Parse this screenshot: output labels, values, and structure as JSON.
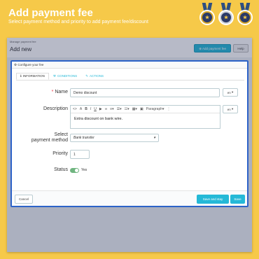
{
  "hero": {
    "title": "Add payment fee",
    "subtitle": "Select payment method and priority to add payment fee/discount"
  },
  "admin": {
    "breadcrumb": "Manage payment fee",
    "page_title": "Add new",
    "add_button": "Add payment fee",
    "help_button": "Help"
  },
  "modal": {
    "title": "Configure your fee",
    "tabs": [
      {
        "label": "INFORMATION",
        "icon": "info-icon"
      },
      {
        "label": "CONDITIONS",
        "icon": "wrench-icon"
      },
      {
        "label": "ACTIONS",
        "icon": "pencil-icon"
      }
    ],
    "fields": {
      "name_label": "Name",
      "name_value": "Demo discount",
      "name_lang": "en",
      "description_label": "Description",
      "description_value": "Extra discount on bank wire.",
      "description_lang": "en",
      "paragraph_label": "Paragraph",
      "payment_label_1": "Select",
      "payment_label_2": "payment method",
      "payment_value": "Bank transfer",
      "priority_label": "Priority",
      "priority_value": "1",
      "status_label": "Status",
      "status_value": "Yes"
    },
    "footer": {
      "cancel": "Cancel",
      "save_stay": "Save and stay",
      "save": "Save"
    }
  },
  "colors": {
    "background": "#f6c949",
    "accent": "#25b9d7",
    "modal_border": "#2d63c8",
    "toggle_on": "#70b580"
  }
}
